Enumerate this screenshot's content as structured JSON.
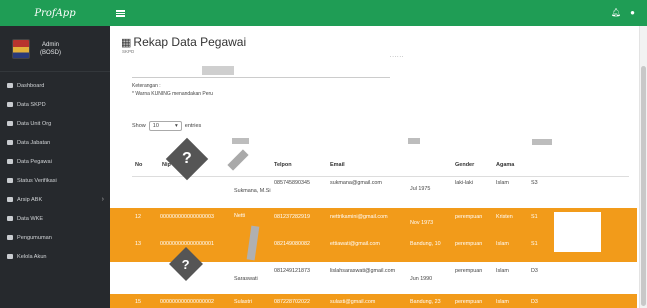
{
  "app": {
    "brand": "ProfApp"
  },
  "user": {
    "name": "Admin",
    "role": "(BOSD)"
  },
  "sidebar": {
    "items": [
      {
        "label": "Dashboard",
        "has_children": false
      },
      {
        "label": "Data SKPD",
        "has_children": false
      },
      {
        "label": "Data Unit Org",
        "has_children": false
      },
      {
        "label": "Data Jabatan",
        "has_children": false
      },
      {
        "label": "Data Pegawai",
        "has_children": false
      },
      {
        "label": "Status Verifikasi",
        "has_children": false
      },
      {
        "label": "Arsip ABK",
        "has_children": true
      },
      {
        "label": "Data WKE",
        "has_children": false
      },
      {
        "label": "Pengumuman",
        "has_children": false
      },
      {
        "label": "Kelola Akun",
        "has_children": false
      }
    ]
  },
  "topbar": {
    "icons": [
      "menu-icon",
      "bell-icon",
      "user-icon"
    ]
  },
  "page": {
    "title": "Rekap Data Pegawai",
    "subtitle": "SKPD",
    "dots": "......",
    "keterangan_label": "Keterangan :",
    "keterangan_text": "* Warna KUNING menandakan Peru",
    "show_label": "Show",
    "show_value": "10",
    "entries_label": "entries"
  },
  "table": {
    "headers": [
      "No",
      "Nip",
      "Telpon",
      "Email",
      "Gender",
      "Agama"
    ],
    "rows": [
      {
        "no": "",
        "nip": "",
        "nama": "Sukmana, M.Si",
        "telpon": "085745890345",
        "email": "sukmana@gmail.com",
        "ttl": "Jul 1975",
        "gender": "laki-laki",
        "agama": "Islam",
        "pend": "S3",
        "highlight": false
      },
      {
        "no": "12",
        "nip": "000000000000000003",
        "nama": "Netti",
        "telpon": "081237282919",
        "email": "nettrikamini@gmail.com",
        "ttl": "Nov 1973",
        "gender": "perempuan",
        "agama": "Kristen",
        "pend": "S1",
        "highlight": true
      },
      {
        "no": "13",
        "nip": "000000000000000001",
        "nama": "",
        "telpon": "082149080082",
        "email": "ettiawati@gmail.com",
        "ttl": "Bandung, 10",
        "gender": "perempuan",
        "agama": "Islam",
        "pend": "S1",
        "highlight": true
      },
      {
        "no": "",
        "nip": "",
        "nama": "Saraswati",
        "telpon": "081249121873",
        "email": "lislahsaraswati@gmail.com",
        "ttl": "Jun 1990",
        "gender": "perempuan",
        "agama": "Islam",
        "pend": "D3",
        "highlight": false
      },
      {
        "no": "15",
        "nip": "000000000000000002",
        "nama": "Sulastri",
        "telpon": "087228702022",
        "email": "sulasti@gmail.com",
        "ttl": "Bandung, 23",
        "gender": "perempuan",
        "agama": "Islam",
        "pend": "D3",
        "highlight": true
      }
    ]
  }
}
